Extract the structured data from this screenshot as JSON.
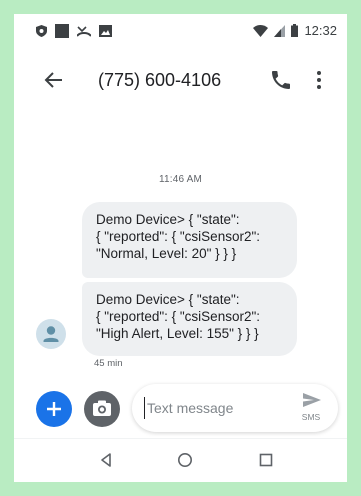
{
  "status_bar": {
    "time": "12:32",
    "icons": [
      "shield-icon",
      "square-icon",
      "missed-call-icon",
      "image-icon",
      "wifi-icon",
      "signal-icon",
      "battery-icon"
    ]
  },
  "app_bar": {
    "contact": "(775) 600-4106",
    "icons": [
      "back-arrow-icon",
      "phone-icon",
      "more-vert-icon"
    ]
  },
  "conversation": {
    "timestamp": "11:46 AM",
    "messages": [
      {
        "lines": [
          "Demo Device> { \"state\":",
          "{ \"reported\": { \"csiSensor2\":",
          "\"Normal, Level: 20\" } } }"
        ]
      },
      {
        "lines": [
          "Demo Device> { \"state\":",
          "{ \"reported\": { \"csiSensor2\":",
          "\"High Alert, Level: 155\" } } }"
        ]
      }
    ],
    "last_message_time": "45 min"
  },
  "compose": {
    "placeholder": "Text message",
    "send_label": "SMS"
  },
  "colors": {
    "accent": "#1a73e8",
    "bubble": "#eef0f2",
    "frame": "#b9ecc2"
  }
}
